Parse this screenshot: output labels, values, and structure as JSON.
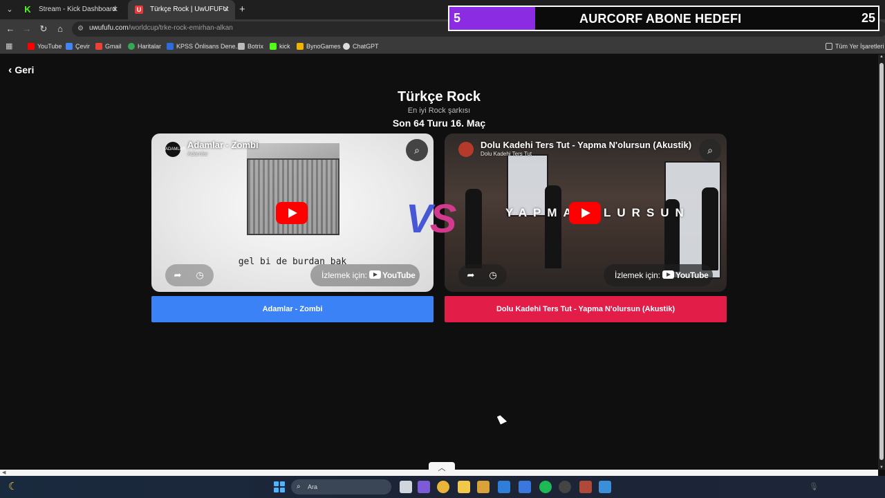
{
  "browser": {
    "tabs": [
      {
        "title": "Stream - Kick Dashboard",
        "icon": "kick-icon",
        "active": false
      },
      {
        "title": "Türkçe Rock | UwUFUFU",
        "icon": "uwufufu-icon",
        "active": true
      }
    ],
    "url_host": "uwufufu.com",
    "url_path": "/worldcup/trke-rock-emirhan-alkan",
    "bookmarks": [
      {
        "label": "YouTube",
        "color": "#ff0000"
      },
      {
        "label": "Çevir",
        "color": "#4285f4"
      },
      {
        "label": "Gmail",
        "color": "#ea4335"
      },
      {
        "label": "Haritalar",
        "color": "#34a853"
      },
      {
        "label": "KPSS Önlisans Dene...",
        "color": "#2d6cdf"
      },
      {
        "label": "Botrix",
        "color": "#bbbbbb"
      },
      {
        "label": "kick",
        "color": "#53fc18"
      },
      {
        "label": "BynoGames",
        "color": "#f0b400"
      },
      {
        "label": "ChatGPT",
        "color": "#dddddd"
      }
    ],
    "all_bookmarks": "Tüm Yer İşaretleri"
  },
  "overlay": {
    "current": "5",
    "title": "AURCORF ABONE HEDEFI",
    "goal": "25",
    "progress_fraction": 0.2,
    "fill_color": "#8b2be2"
  },
  "page": {
    "back_label": "Geri",
    "title": "Türkçe Rock",
    "subtitle": "En iyi Rock şarkısı",
    "round": "Son 64 Turu 16. Maç",
    "vs": {
      "v": "V",
      "s": "S"
    },
    "watch_label": "İzlemek için:",
    "youtube_label": "YouTube",
    "left": {
      "video_title": "Adamlar - Zombi",
      "channel": "Adamlar",
      "channel_badge": "ADAMLAR",
      "lyric": "gel bi de burdan bak",
      "choice": "Adamlar - Zombi",
      "button_color": "#3b82f6"
    },
    "right": {
      "video_title": "Dolu Kadehi Ters Tut - Yapma N'olursun (Akustik)",
      "channel": "Dolu Kadehi Ters Tut",
      "wall_left": "YAPMA",
      "wall_right": "LURSUN",
      "choice": "Dolu Kadehi Ters Tut - Yapma N'olursun (Akustik)",
      "button_color": "#e11d48"
    }
  },
  "taskbar": {
    "search_placeholder": "Ara"
  }
}
